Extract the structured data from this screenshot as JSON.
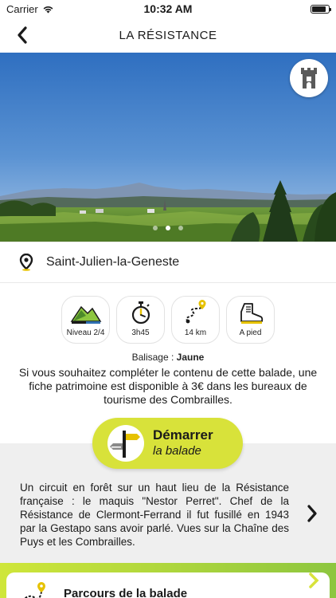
{
  "status": {
    "carrier": "Carrier",
    "time": "10:32 AM",
    "battery_level": 0.85
  },
  "nav": {
    "title": "LA RÉSISTANCE"
  },
  "gallery": {
    "page_count": 3,
    "active_page": 2
  },
  "location": {
    "name": "Saint-Julien-la-Geneste"
  },
  "features": [
    {
      "icon": "difficulty-hills-icon",
      "label": "Niveau 2/4"
    },
    {
      "icon": "stopwatch-icon",
      "label": "3h45"
    },
    {
      "icon": "route-distance-icon",
      "label": "14 km"
    },
    {
      "icon": "hiking-boot-icon",
      "label": "A pied"
    }
  ],
  "balisage": {
    "label": "Balisage :",
    "value": "Jaune"
  },
  "notice": "Si vous souhaitez compléter le contenu de cette balade, une fiche patrimoine est disponible à 3€ dans les bureaux de tourisme des Combrailles.",
  "start_button": {
    "line1": "Démarrer",
    "line2": "la balade",
    "icon": "signpost-icon"
  },
  "description": "Un circuit en forêt sur un haut lieu de la Résistance française : le maquis \"Nestor Perret\". Chef de la Résistance de Clermont-Ferrand il fut fusillé en 1943 par la Gestapo sans avoir parlé. Vues sur la Chaîne des Puys et les Combrailles.",
  "route_card": {
    "label": "Parcours de la balade",
    "icon": "route-map-icon"
  },
  "colors": {
    "accent": "#d8e23a",
    "accent_dark": "#8dc63f",
    "grey_bg": "#efefef"
  }
}
